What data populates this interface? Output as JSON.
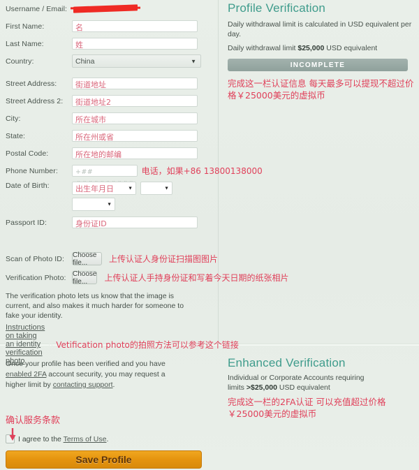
{
  "form": {
    "fields": [
      {
        "label": "Username / Email:",
        "type": "redacted",
        "value": ""
      },
      {
        "label": "First Name:",
        "type": "text",
        "value": "名"
      },
      {
        "label": "Last Name:",
        "type": "text",
        "value": "姓"
      },
      {
        "label": "Country:",
        "type": "select",
        "value": "China"
      },
      {
        "label": "Street Address:",
        "type": "text",
        "value": "街道地址"
      },
      {
        "label": "Street Address 2:",
        "type": "text",
        "value": "街道地址2"
      },
      {
        "label": "City:",
        "type": "text",
        "value": "所在城市"
      },
      {
        "label": "State:",
        "type": "text",
        "value": "所在州或省"
      },
      {
        "label": "Postal Code:",
        "type": "text",
        "value": "所在地的邮编"
      }
    ],
    "phone": {
      "label": "Phone Number:",
      "placeholder": "+## ##########",
      "note": "电话，如果+86 13800138000"
    },
    "dob": {
      "label": "Date of Birth:",
      "select1": "出生年月日",
      "select2": "",
      "select3": ""
    },
    "passport": {
      "label": "Passport ID:",
      "value": "身份证ID"
    },
    "scan_id": {
      "label": "Scan of Photo ID:",
      "button": "Choose file...",
      "note": "上传认证人身份证扫描图图片"
    },
    "verification_photo": {
      "label": "Verification Photo:",
      "button": "Choose file...",
      "note": "上传认证人手持身份证和写着今天日期的纸张相片"
    },
    "help_text": "The verification photo lets us know that the image is current, and also makes it much harder for someone to fake your identity.",
    "instructions_link": "Instructions on taking an identity verification photo",
    "instructions_note": "Vetification photo的拍照方法可以参考这个链接"
  },
  "profile_verification": {
    "title": "Profile Verification",
    "description": "Daily withdrawal limit is calculated in USD equivalent per day.",
    "limit_prefix": "Daily withdrawal limit ",
    "limit_amount": "$25,000",
    "limit_suffix": " USD equivalent",
    "status_badge": "INCOMPLETE",
    "red_note": "完成这一栏认证信息 每天最多可以提现不超过价格￥25000美元的虚拟币"
  },
  "enhanced_verification": {
    "title": "Enhanced Verification",
    "description_1": "Individual or Corporate Accounts requiring",
    "description_2_prefix": "limits ",
    "description_2_amount": ">$25,000",
    "description_2_suffix": " USD equivalent",
    "red_note": "完成这一栏的2FA认证 可以充值超过价格￥25000美元的虚拟币"
  },
  "footer": {
    "paragraph_1": "Once your profile has been verified and you have",
    "link_2fa": "enabled 2FA",
    "paragraph_2": " account security, you may request a higher",
    "paragraph_3": "limit by ",
    "link_support": "contacting support",
    "paragraph_4": ".",
    "terms_note": "确认服务条款",
    "agree_prefix": "I agree to the ",
    "terms_link": "Terms of Use",
    "agree_suffix": ".",
    "save_button": "Save Profile"
  }
}
